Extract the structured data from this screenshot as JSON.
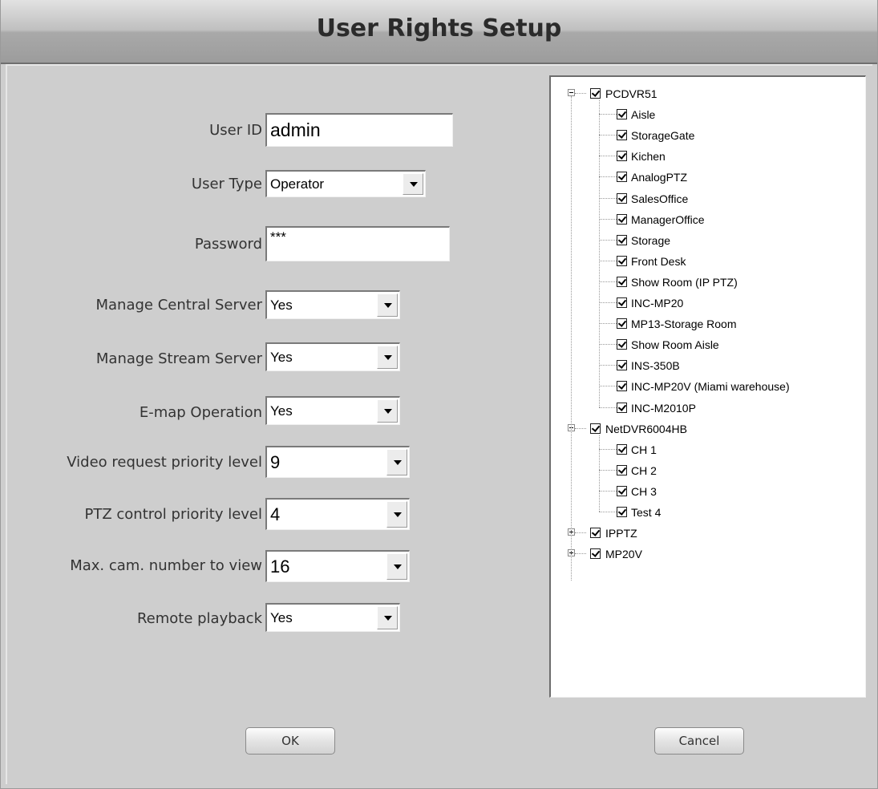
{
  "title": "User Rights Setup",
  "fields": {
    "user_id": {
      "label": "User ID",
      "value": "admin"
    },
    "user_type": {
      "label": "User Type",
      "value": "Operator"
    },
    "password": {
      "label": "Password",
      "value": "***"
    },
    "manage_central_server": {
      "label": "Manage Central Server",
      "value": "Yes"
    },
    "manage_stream_server": {
      "label": "Manage Stream Server",
      "value": "Yes"
    },
    "emap_operation": {
      "label": "E-map Operation",
      "value": "Yes"
    },
    "video_priority": {
      "label": "Video request priority level",
      "value": "9"
    },
    "ptz_priority": {
      "label": "PTZ control priority level",
      "value": "4"
    },
    "max_cam": {
      "label": "Max. cam. number to view",
      "value": "16"
    },
    "remote_playback": {
      "label": "Remote playback",
      "value": "Yes"
    }
  },
  "tree": {
    "nodes": [
      {
        "label": "PCDVR51",
        "expanded": true,
        "checked": true,
        "children": [
          "Aisle",
          "StorageGate",
          "Kichen",
          "AnalogPTZ",
          "SalesOffice",
          "ManagerOffice",
          "Storage",
          "Front Desk",
          "Show Room (IP PTZ)",
          "INC-MP20",
          "MP13-Storage Room",
          "Show Room Aisle",
          "INS-350B",
          "INC-MP20V (Miami warehouse)",
          "INC-M2010P"
        ]
      },
      {
        "label": "NetDVR6004HB",
        "expanded": true,
        "checked": true,
        "children": [
          "CH 1",
          "CH 2",
          "CH 3",
          "Test 4"
        ]
      },
      {
        "label": "IPPTZ",
        "expanded": false,
        "checked": true,
        "children": []
      },
      {
        "label": "MP20V",
        "expanded": false,
        "checked": true,
        "children": []
      }
    ]
  },
  "buttons": {
    "ok": "OK",
    "cancel": "Cancel"
  }
}
